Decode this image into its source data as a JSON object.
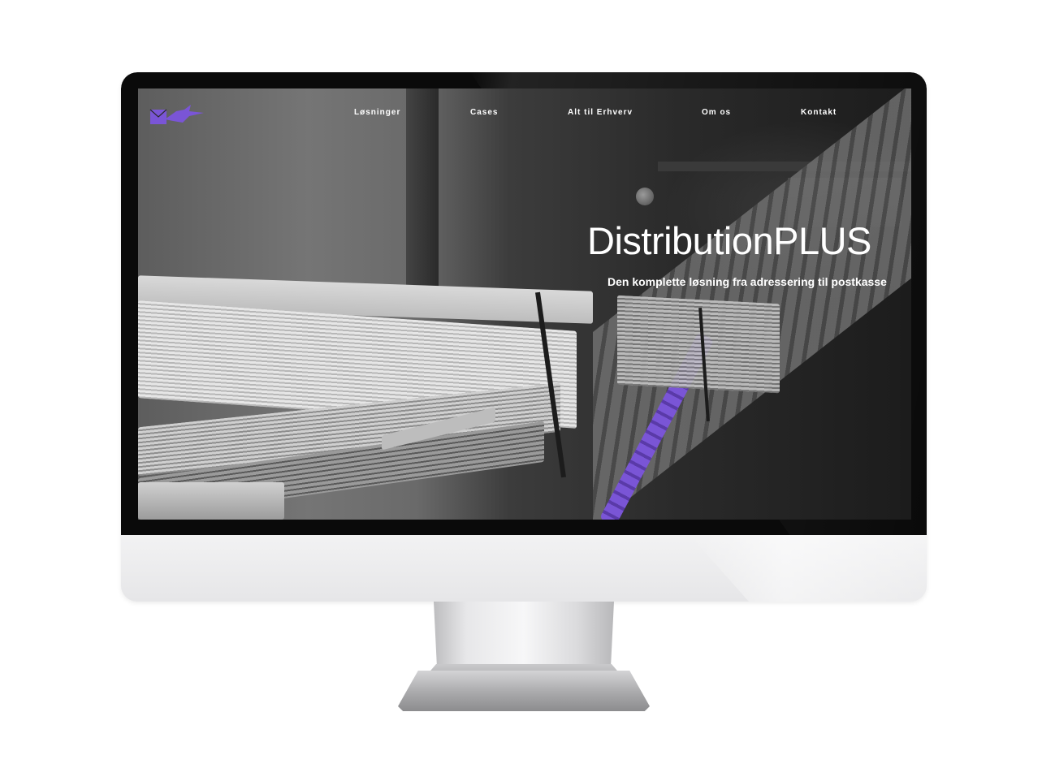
{
  "brand": {
    "logo_icon": "bird-envelope-logo",
    "accent_color": "#7a55d6"
  },
  "nav": {
    "items": [
      {
        "label": "Løsninger"
      },
      {
        "label": "Cases"
      },
      {
        "label": "Alt til Erhverv"
      },
      {
        "label": "Om os"
      },
      {
        "label": "Kontakt"
      }
    ]
  },
  "hero": {
    "title": "DistributionPLUS",
    "subtitle": "Den komplette løsning fra adressering til postkasse"
  }
}
